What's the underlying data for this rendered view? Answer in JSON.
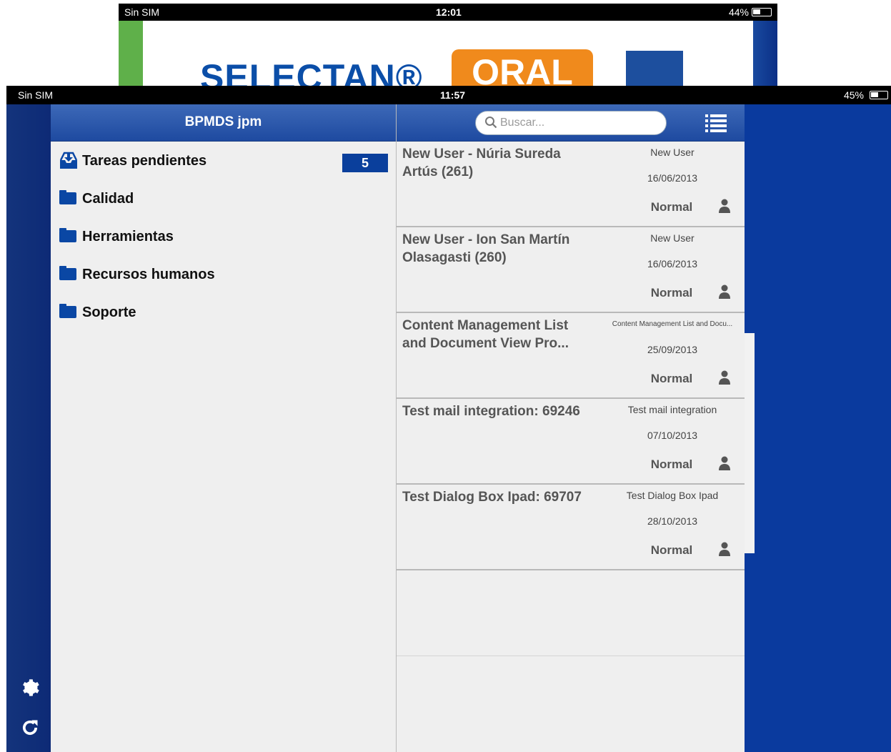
{
  "background_screen": {
    "status": {
      "carrier": "Sin SIM",
      "time": "12:01",
      "battery": "44%"
    },
    "brand_text": "SELECTAN®",
    "brand_badge": "ORAL"
  },
  "status": {
    "carrier": "Sin SIM",
    "time": "11:57",
    "battery": "45%"
  },
  "left_panel": {
    "title": "BPMDS jpm",
    "items": [
      {
        "label": "Tareas pendientes",
        "icon": "inbox-download-icon",
        "count": "5"
      },
      {
        "label": "Calidad",
        "icon": "folder-icon"
      },
      {
        "label": "Herramientas",
        "icon": "folder-icon"
      },
      {
        "label": "Recursos humanos",
        "icon": "folder-icon"
      },
      {
        "label": "Soporte",
        "icon": "folder-icon"
      }
    ]
  },
  "rail": {
    "settings_icon": "gear-icon",
    "refresh_icon": "refresh-icon"
  },
  "search": {
    "placeholder": "Buscar..."
  },
  "tasks": [
    {
      "title": "New User - Núria Sureda Artús (261)",
      "type": "New User",
      "date": "16/06/2013",
      "priority": "Normal"
    },
    {
      "title": "New User - Ion San Martín Olasagasti (260)",
      "type": "New User",
      "date": "16/06/2013",
      "priority": "Normal"
    },
    {
      "title": "Content Management List and Document View Pro...",
      "type": "Content Management List and Docu...",
      "date": "25/09/2013",
      "priority": "Normal"
    },
    {
      "title": "Test mail integration: 69246",
      "type": "Test mail integration",
      "date": "07/10/2013",
      "priority": "Normal"
    },
    {
      "title": "Test Dialog Box Ipad: 69707",
      "type": "Test Dialog Box Ipad",
      "date": "28/10/2013",
      "priority": "Normal"
    }
  ],
  "colors": {
    "accent": "#0a3f9c",
    "header": "#2a56aa",
    "background": "#0a3a9e"
  }
}
